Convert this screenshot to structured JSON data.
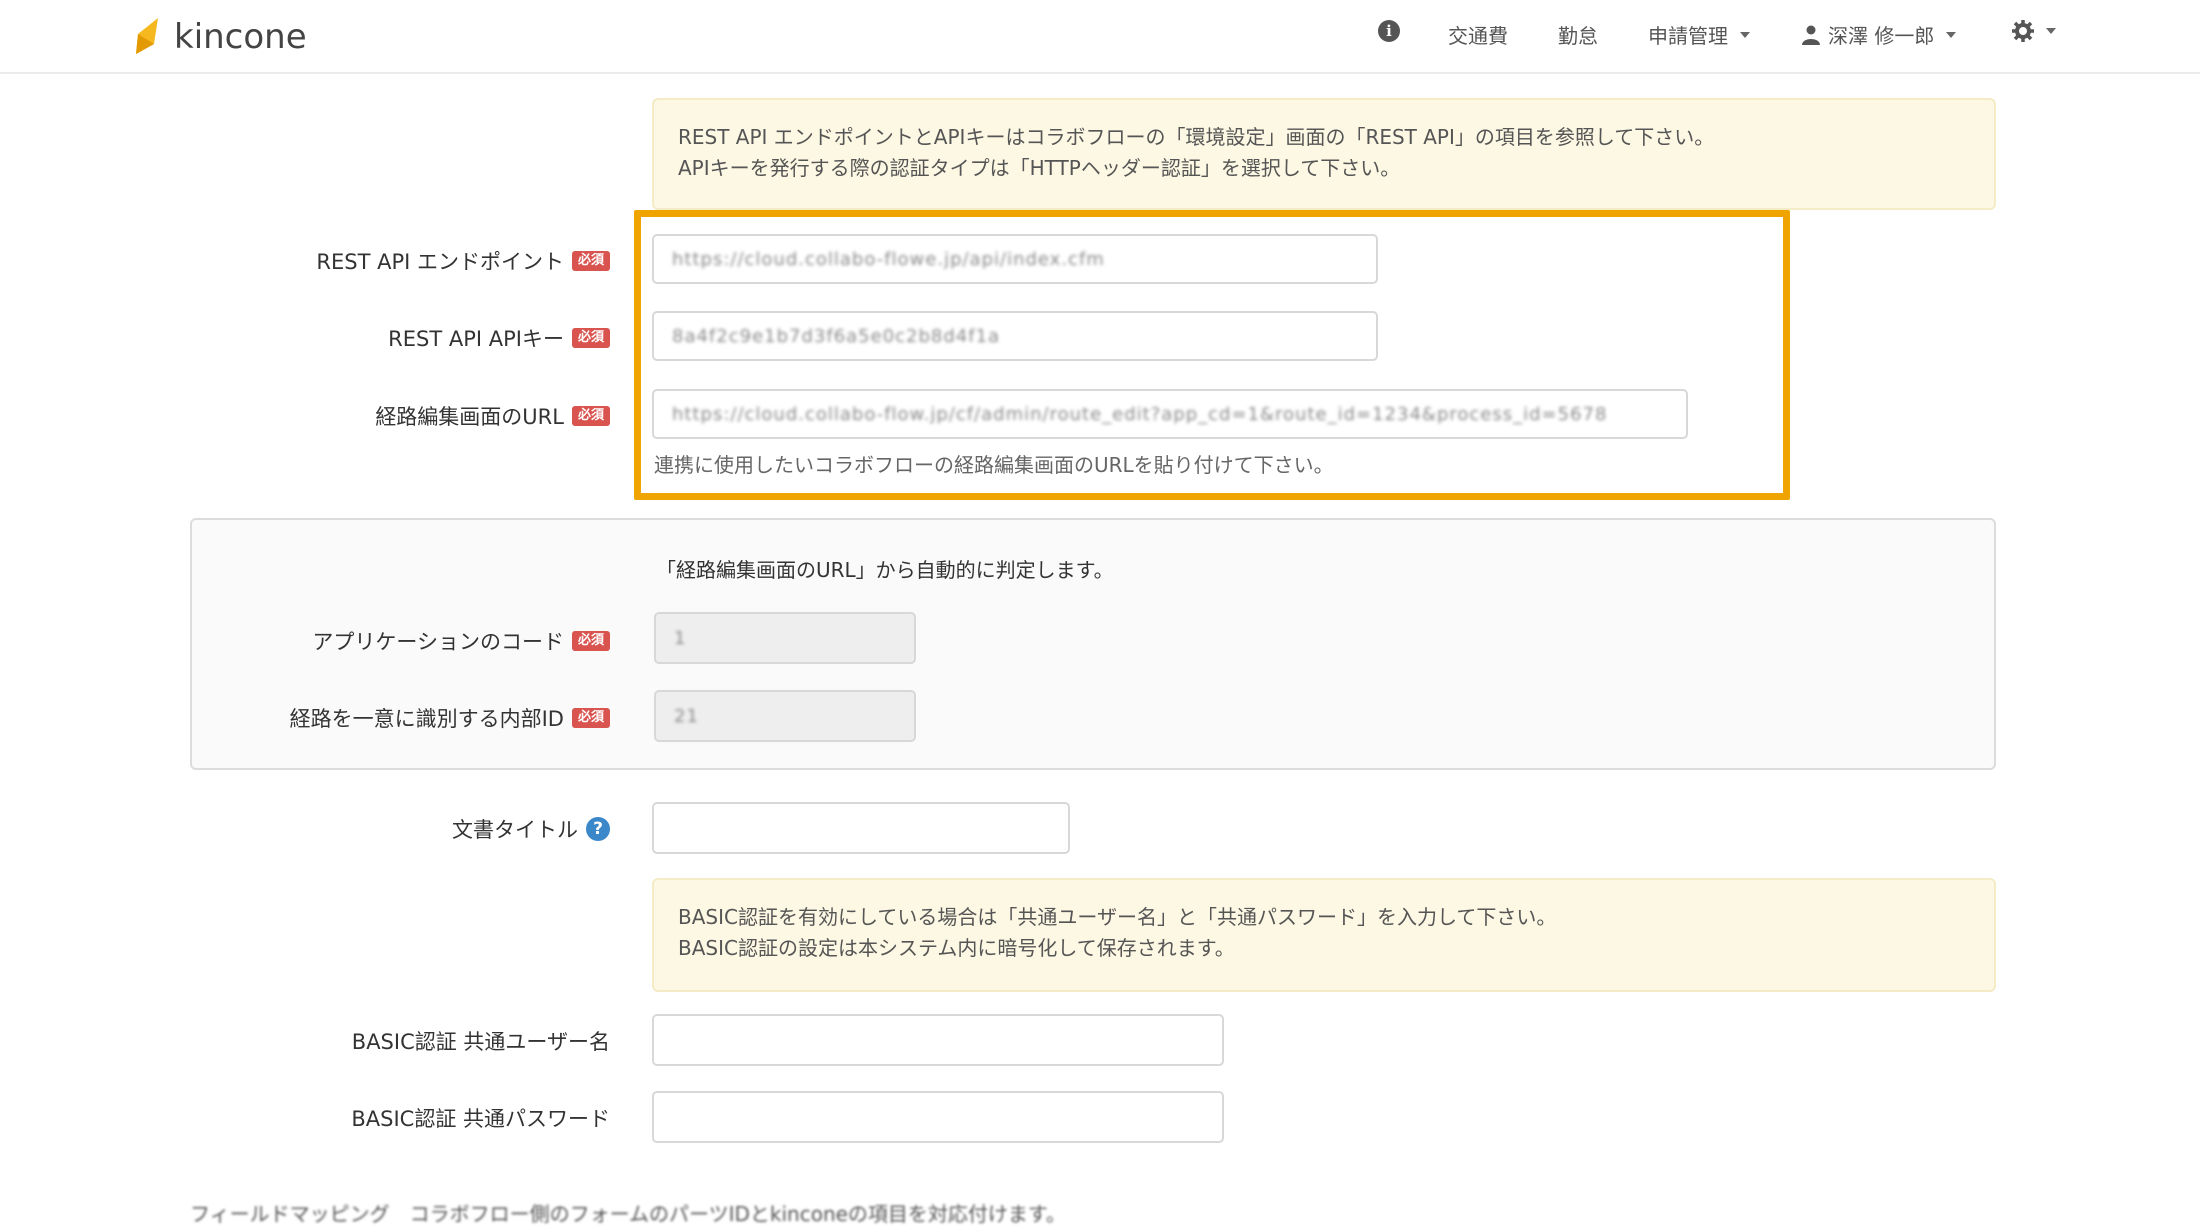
{
  "navbar": {
    "logo_text": "kincone",
    "items": [
      {
        "label": "交通費"
      },
      {
        "label": "勤怠"
      },
      {
        "label": "申請管理"
      },
      {
        "label": "深澤 修一郎"
      }
    ],
    "info_icon": "info-icon",
    "user_icon": "user-icon",
    "settings_icon": "gear-icon"
  },
  "alert_api": {
    "line1": "REST API エンドポイントとAPIキーはコラボフローの「環境設定」画面の「REST API」の項目を参照して下さい。",
    "line2": "APIキーを発行する際の認証タイプは「HTTPヘッダー認証」を選択して下さい。"
  },
  "required_badge": "必須",
  "fields": {
    "endpoint": {
      "label": "REST API エンドポイント",
      "value": "https://cloud.collabo-flowe.jp/api/index.cfm"
    },
    "api_key": {
      "label": "REST API APIキー",
      "value": "8a4f2c9e1b7d3f6a5e0c2b8d4f1a"
    },
    "route_url": {
      "label": "経路編集画面のURL",
      "value": "https://cloud.collabo-flow.jp/cf/admin/route_edit?app_cd=1&route_id=1234&process_id=5678",
      "help": "連携に使用したいコラボフローの経路編集画面のURLを貼り付けて下さい。"
    }
  },
  "auto_panel": {
    "note": "「経路編集画面のURL」から自動的に判定します。",
    "app_code": {
      "label": "アプリケーションのコード",
      "value": "1"
    },
    "route_id": {
      "label": "経路を一意に識別する内部ID",
      "value": "21"
    }
  },
  "doc_title": {
    "label": "文書タイトル",
    "value": ""
  },
  "alert_basic": {
    "line1": "BASIC認証を有効にしている場合は「共通ユーザー名」と「共通パスワード」を入力して下さい。",
    "line2": "BASIC認証の設定は本システム内に暗号化して保存されます。"
  },
  "basic_user": {
    "label": "BASIC認証 共通ユーザー名",
    "value": ""
  },
  "basic_password": {
    "label": "BASIC認証 共通パスワード",
    "value": ""
  },
  "bottom_text": "フィールドマッピング　コラボフロー側のフォームのパーツIDとkinconeの項目を対応付けます。"
}
